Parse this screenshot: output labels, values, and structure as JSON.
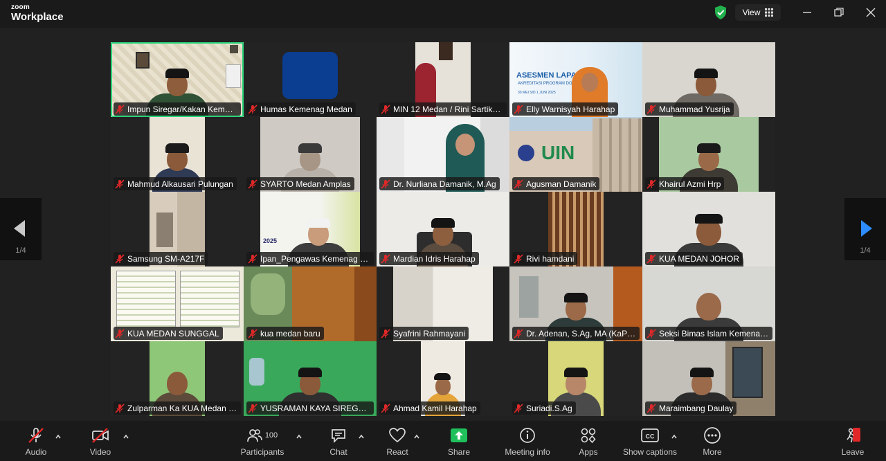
{
  "app": {
    "brand_top": "zoom",
    "brand_name": "Workplace",
    "view_label": "View"
  },
  "pager": {
    "left_page": "1/4",
    "right_page": "1/4"
  },
  "participants": [
    {
      "name": "Impun Siregar/Kakan Kemenag ..."
    },
    {
      "name": "Humas Kemenag Medan"
    },
    {
      "name": "MIN 12 Medan / Rini Sartika..."
    },
    {
      "name": "Elly Warnisyah Harahap"
    },
    {
      "name": "Muhammad Yusrija"
    },
    {
      "name": "Mahmud Alkausari Pulungan"
    },
    {
      "name": "SYARTO Medan Amplas"
    },
    {
      "name": "Dr. Nurliana Damanik, M.Ag"
    },
    {
      "name": "Agusman Damanik"
    },
    {
      "name": "Khairul Azmi Hrp"
    },
    {
      "name": "Samsung SM-A217F"
    },
    {
      "name": "Ipan_Pengawas Kemenag M..."
    },
    {
      "name": "Mardian Idris Harahap"
    },
    {
      "name": "Rivi hamdani"
    },
    {
      "name": "KUA MEDAN JOHOR"
    },
    {
      "name": "KUA MEDAN SUNGGAL"
    },
    {
      "name": "kua medan baru"
    },
    {
      "name": "Syafrini Rahmayani"
    },
    {
      "name": "Dr. Adenan, S.Ag, MA (KaPro..."
    },
    {
      "name": "Seksi Bimas Islam Kemenag ..."
    },
    {
      "name": "Zulparman Ka KUA Medan L..."
    },
    {
      "name": "YUSRAMAN KAYA SIREGAR_..."
    },
    {
      "name": "Ahmad Kamil Harahap"
    },
    {
      "name": "Suriadi.S.Ag"
    },
    {
      "name": "Maraimbang Daulay"
    }
  ],
  "tile_text": {
    "asesmen_title": "ASESMEN LAPANGAN",
    "asesmen_sub": "AKREDITASI PROGRAM DOKT",
    "asesmen_date": "30 MEI S/D 1 JUNI 2025",
    "uin_sign": "UIN",
    "slide_year": "2025"
  },
  "toolbar": {
    "audio": "Audio",
    "video": "Video",
    "participants": "Participants",
    "participants_count": "100",
    "chat": "Chat",
    "react": "React",
    "share": "Share",
    "meeting_info": "Meeting info",
    "apps": "Apps",
    "show_captions": "Show captions",
    "more": "More",
    "leave": "Leave"
  },
  "colors": {
    "active_speaker": "#2ad47a",
    "share_green": "#1fc05b",
    "muted_red": "#e02828",
    "pager_arrow": "#2d8cff"
  }
}
